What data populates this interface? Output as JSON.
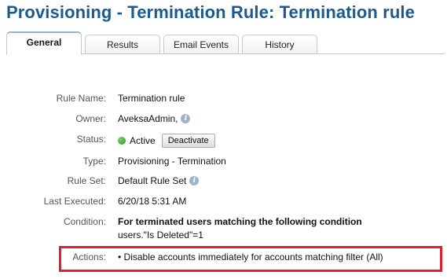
{
  "page": {
    "title": "Provisioning - Termination Rule: Termination rule"
  },
  "tabs": [
    {
      "label": "General",
      "active": true
    },
    {
      "label": "Results",
      "active": false
    },
    {
      "label": "Email Events",
      "active": false
    },
    {
      "label": "History",
      "active": false
    }
  ],
  "details": {
    "rule_name": {
      "label": "Rule Name:",
      "value": "Termination rule"
    },
    "owner": {
      "label": "Owner:",
      "value": "AveksaAdmin,"
    },
    "status": {
      "label": "Status:",
      "value": "Active",
      "button": "Deactivate",
      "indicator_color": "#3aa02a"
    },
    "type": {
      "label": "Type:",
      "value": "Provisioning - Termination"
    },
    "rule_set": {
      "label": "Rule Set:",
      "value": "Default Rule Set"
    },
    "last_executed": {
      "label": "Last Executed:",
      "value": "6/20/18 5:31 AM"
    },
    "condition": {
      "label": "Condition:",
      "title": "For terminated users matching the following condition",
      "expression": "users.\"Is Deleted\"=1"
    },
    "actions": {
      "label": "Actions:",
      "items": [
        "• Disable accounts immediately for accounts matching filter (All)"
      ]
    }
  },
  "colors": {
    "title": "#1b5a8f",
    "highlight_border": "#e0202e"
  },
  "icons": {
    "info": "info-icon",
    "status": "status-active-icon"
  }
}
